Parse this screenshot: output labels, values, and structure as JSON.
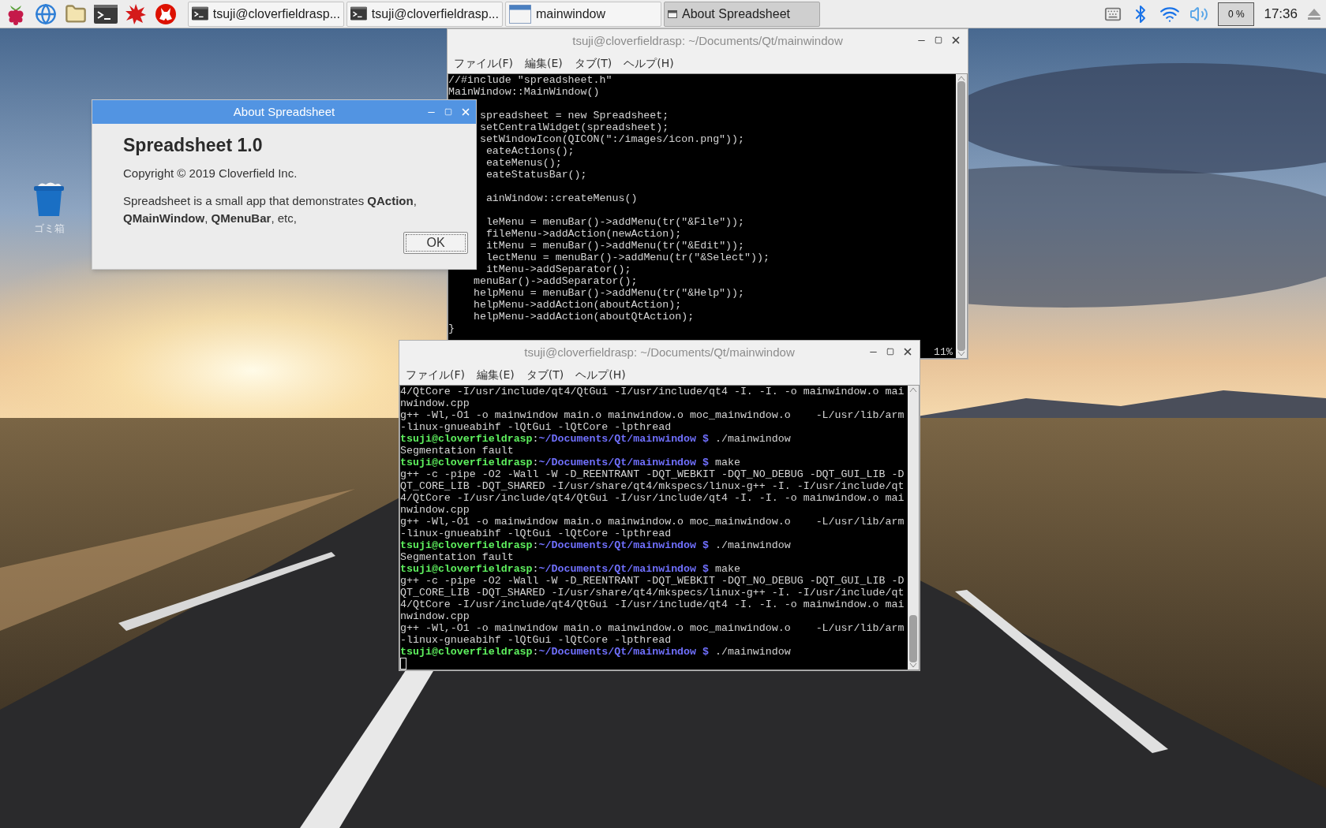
{
  "taskbar": {
    "tasks": [
      {
        "label": "tsuji@cloverfieldrasp...",
        "kind": "terminal",
        "selected": false
      },
      {
        "label": "tsuji@cloverfieldrasp...",
        "kind": "terminal",
        "selected": false
      },
      {
        "label": "mainwindow",
        "kind": "window",
        "selected": false
      },
      {
        "label": "About Spreadsheet",
        "kind": "small-window",
        "selected": true
      }
    ],
    "tray": {
      "cpu": "0 %",
      "clock": "17:36"
    }
  },
  "desktop_icons": [
    {
      "label": "ゴミ箱"
    }
  ],
  "terminals": [
    {
      "title": "tsuji@cloverfieldrasp: ~/Documents/Qt/mainwindow",
      "menu": [
        "ファイル(F)",
        "編集(E)",
        "タブ(T)",
        "ヘルプ(H)"
      ],
      "status": "11%",
      "lines": [
        {
          "kind": "output",
          "text": "//#include \"spreadsheet.h\""
        },
        {
          "kind": "output",
          "text": "MainWindow::MainWindow()"
        },
        {
          "kind": "blank"
        },
        {
          "kind": "output",
          "text": "     spreadsheet = new Spreadsheet;"
        },
        {
          "kind": "output",
          "text": "     setCentralWidget(spreadsheet);"
        },
        {
          "kind": "output",
          "text": "     setWindowIcon(QICON(\":/images/icon.png\"));"
        },
        {
          "kind": "output",
          "text": "      eateActions();"
        },
        {
          "kind": "output",
          "text": "      eateMenus();"
        },
        {
          "kind": "output",
          "text": "      eateStatusBar();"
        },
        {
          "kind": "blank"
        },
        {
          "kind": "output",
          "text": "      ainWindow::createMenus()"
        },
        {
          "kind": "blank"
        },
        {
          "kind": "output",
          "text": "      leMenu = menuBar()->addMenu(tr(\"&File\"));"
        },
        {
          "kind": "output",
          "text": "      fileMenu->addAction(newAction);"
        },
        {
          "kind": "output",
          "text": "      itMenu = menuBar()->addMenu(tr(\"&Edit\"));"
        },
        {
          "kind": "output",
          "text": "      lectMenu = menuBar()->addMenu(tr(\"&Select\"));"
        },
        {
          "kind": "output",
          "text": "      itMenu->addSeparator();"
        },
        {
          "kind": "output",
          "text": "    menuBar()->addSeparator();"
        },
        {
          "kind": "output",
          "text": "    helpMenu = menuBar()->addMenu(tr(\"&Help\"));"
        },
        {
          "kind": "output",
          "text": "    helpMenu->addAction(aboutAction);"
        },
        {
          "kind": "output",
          "text": "    helpMenu->addAction(aboutQtAction);"
        },
        {
          "kind": "output",
          "text": "}"
        },
        {
          "kind": "blank"
        }
      ]
    },
    {
      "title": "tsuji@cloverfieldrasp: ~/Documents/Qt/mainwindow",
      "menu": [
        "ファイル(F)",
        "編集(E)",
        "タブ(T)",
        "ヘルプ(H)"
      ],
      "lines": [
        {
          "kind": "output",
          "text": "4/QtCore -I/usr/include/qt4/QtGui -I/usr/include/qt4 -I. -I. -o mainwindow.o mai"
        },
        {
          "kind": "output",
          "text": "nwindow.cpp"
        },
        {
          "kind": "output",
          "text": "g++ -Wl,-O1 -o mainwindow main.o mainwindow.o moc_mainwindow.o    -L/usr/lib/arm"
        },
        {
          "kind": "output",
          "text": "-linux-gnueabihf -lQtGui -lQtCore -lpthread"
        },
        {
          "kind": "prompt",
          "user": "tsuji@cloverfieldrasp",
          "sep": ":",
          "path": "~/Documents/Qt/mainwindow $",
          "command": " ./mainwindow"
        },
        {
          "kind": "output",
          "text": "Segmentation fault"
        },
        {
          "kind": "prompt",
          "user": "tsuji@cloverfieldrasp",
          "sep": ":",
          "path": "~/Documents/Qt/mainwindow $",
          "command": " make"
        },
        {
          "kind": "output",
          "text": "g++ -c -pipe -O2 -Wall -W -D_REENTRANT -DQT_WEBKIT -DQT_NO_DEBUG -DQT_GUI_LIB -D"
        },
        {
          "kind": "output",
          "text": "QT_CORE_LIB -DQT_SHARED -I/usr/share/qt4/mkspecs/linux-g++ -I. -I/usr/include/qt"
        },
        {
          "kind": "output",
          "text": "4/QtCore -I/usr/include/qt4/QtGui -I/usr/include/qt4 -I. -I. -o mainwindow.o mai"
        },
        {
          "kind": "output",
          "text": "nwindow.cpp"
        },
        {
          "kind": "output",
          "text": "g++ -Wl,-O1 -o mainwindow main.o mainwindow.o moc_mainwindow.o    -L/usr/lib/arm"
        },
        {
          "kind": "output",
          "text": "-linux-gnueabihf -lQtGui -lQtCore -lpthread"
        },
        {
          "kind": "prompt",
          "user": "tsuji@cloverfieldrasp",
          "sep": ":",
          "path": "~/Documents/Qt/mainwindow $",
          "command": " ./mainwindow"
        },
        {
          "kind": "output",
          "text": "Segmentation fault"
        },
        {
          "kind": "prompt",
          "user": "tsuji@cloverfieldrasp",
          "sep": ":",
          "path": "~/Documents/Qt/mainwindow $",
          "command": " make"
        },
        {
          "kind": "output",
          "text": "g++ -c -pipe -O2 -Wall -W -D_REENTRANT -DQT_WEBKIT -DQT_NO_DEBUG -DQT_GUI_LIB -D"
        },
        {
          "kind": "output",
          "text": "QT_CORE_LIB -DQT_SHARED -I/usr/share/qt4/mkspecs/linux-g++ -I. -I/usr/include/qt"
        },
        {
          "kind": "output",
          "text": "4/QtCore -I/usr/include/qt4/QtGui -I/usr/include/qt4 -I. -I. -o mainwindow.o mai"
        },
        {
          "kind": "output",
          "text": "nwindow.cpp"
        },
        {
          "kind": "output",
          "text": "g++ -Wl,-O1 -o mainwindow main.o mainwindow.o moc_mainwindow.o    -L/usr/lib/arm"
        },
        {
          "kind": "output",
          "text": "-linux-gnueabihf -lQtGui -lQtCore -lpthread"
        },
        {
          "kind": "prompt",
          "user": "tsuji@cloverfieldrasp",
          "sep": ":",
          "path": "~/Documents/Qt/mainwindow $",
          "command": " ./mainwindow"
        },
        {
          "kind": "cursor"
        }
      ]
    }
  ],
  "dialog": {
    "title": "About Spreadsheet",
    "heading": "Spreadsheet 1.0",
    "copyright": "Copyright © 2019 Cloverfield Inc.",
    "description": "Spreadsheet is a small app that demonstrates **QAction**, **QMainWindow**, **QMenuBar**, etc,",
    "button": "OK"
  }
}
